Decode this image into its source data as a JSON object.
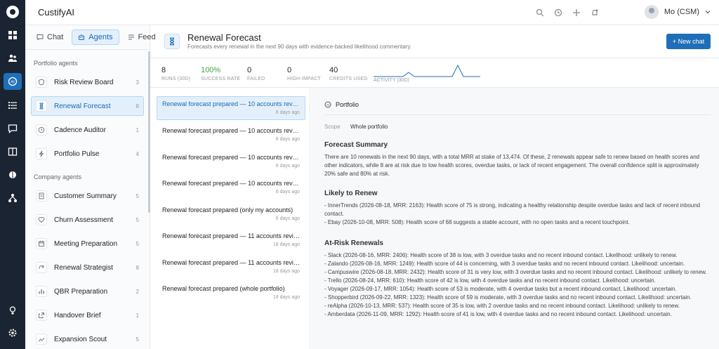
{
  "app": {
    "name": "CustifyAI",
    "user": "Mo (CSM)"
  },
  "rail": {
    "icons": [
      "dashboard-icon",
      "people-icon",
      "agents-icon",
      "list-icon",
      "chat-icon",
      "book-icon",
      "brain-icon",
      "network-icon",
      "bulb-icon",
      "settings-icon"
    ]
  },
  "sidebar": {
    "tabs": [
      {
        "label": "Chat"
      },
      {
        "label": "Agents"
      },
      {
        "label": "Feed"
      }
    ],
    "portfolio_title": "Portfolio agents",
    "portfolio": [
      {
        "label": "Risk Review Board",
        "count": "3"
      },
      {
        "label": "Renewal Forecast",
        "count": "8"
      },
      {
        "label": "Cadence Auditor",
        "count": "1"
      },
      {
        "label": "Portfolio Pulse",
        "count": "4"
      }
    ],
    "company_title": "Company agents",
    "company": [
      {
        "label": "Customer Summary",
        "count": "5"
      },
      {
        "label": "Churn Assessment",
        "count": "5"
      },
      {
        "label": "Meeting Preparation",
        "count": "5"
      },
      {
        "label": "Renewal Strategist",
        "count": "8"
      },
      {
        "label": "QBR Preparation",
        "count": "2"
      },
      {
        "label": "Handover Brief",
        "count": "1"
      },
      {
        "label": "Expansion Scout",
        "count": "5"
      }
    ]
  },
  "header": {
    "title": "Renewal Forecast",
    "subtitle": "Forecasts every renewal in the next 90 days with evidence-backed likelihood commentary.",
    "new_chat": "+ New chat"
  },
  "stats": [
    {
      "value": "8",
      "label": "RUNS (30D)"
    },
    {
      "value": "100%",
      "label": "SUCCESS RATE"
    },
    {
      "value": "0",
      "label": "FAILED"
    },
    {
      "value": "0",
      "label": "HIGH-IMPACT"
    },
    {
      "value": "40",
      "label": "CREDITS USED"
    }
  ],
  "activity_label": "ACTIVITY (30D)",
  "runs": [
    {
      "title": "Renewal forecast prepared — 10 accounts reviewed...",
      "date": "6 days ago"
    },
    {
      "title": "Renewal forecast prepared — 10 accounts reviewed...",
      "date": "6 days ago"
    },
    {
      "title": "Renewal forecast prepared — 10 accounts reviewed...",
      "date": "6 days ago"
    },
    {
      "title": "Renewal forecast prepared — 10 accounts reviewed...",
      "date": "6 days ago"
    },
    {
      "title": "Renewal forecast prepared (only my accounts)",
      "date": "6 days ago"
    },
    {
      "title": "Renewal forecast prepared — 11 accounts reviewed...",
      "date": "18 days ago"
    },
    {
      "title": "Renewal forecast prepared — 11 accounts reviewed...",
      "date": "18 days ago"
    },
    {
      "title": "Renewal forecast prepared (whole portfolio)",
      "date": "18 days ago"
    }
  ],
  "detail": {
    "tag": "Portfolio",
    "scope_label": "Scope",
    "scope_value": "Whole portfolio",
    "summary_title": "Forecast Summary",
    "summary": "There are 10 renewals in the next 90 days, with a total MRR at stake of 13,474. Of these, 2 renewals appear safe to renew based on health scores and other indicators, while 8 are at risk due to low health scores, overdue tasks, or lack of recent engagement. The overall confidence split is approximately 20% safe and 80% at risk.",
    "likely_title": "Likely to Renew",
    "likely": [
      "- InnerTrends (2026-08-18, MRR: 2163): Health score of 75 is strong, indicating a healthy relationship despite overdue tasks and lack of recent inbound contact.",
      "- Ebay (2026-10-08, MRR: 508): Health score of 68 suggests a stable account, with no open tasks and a recent touchpoint."
    ],
    "risk_title": "At-Risk Renewals",
    "risk": [
      "- Slack (2026-08-16, MRR: 2406): Health score of 38 is low, with 3 overdue tasks and no recent inbound contact. Likelihood: unlikely to renew.",
      "- Zalando (2026-08-16, MRR: 1249): Health score of 44 is concerning, with 3 overdue tasks and no recent inbound contact. Likelihood: uncertain.",
      "- Campuswire (2026-08-18, MRR: 2432): Health score of 31 is very low, with 3 overdue tasks and no recent inbound contact. Likelihood: unlikely to renew.",
      "- Trello (2026-08-24, MRR: 610): Health score of 42 is low, with 4 overdue tasks and no recent inbound contact. Likelihood: uncertain.",
      "- Voyager (2026-09-17, MRR: 1054): Health score of 53 is moderate, with 4 overdue tasks but a recent inbound contact. Likelihood: uncertain.",
      "- Shopperbird (2026-09-22, MRR: 1323): Health score of 59 is moderate, with 3 overdue tasks and no recent inbound contact. Likelihood: uncertain.",
      "- reAlpha (2026-10-13, MRR: 537): Health score of 35 is low, with 2 overdue tasks and no recent inbound contact. Likelihood: unlikely to renew.",
      "- Amberdata (2026-11-09, MRR: 1292): Health score of 41 is low, with 4 overdue tasks and no recent inbound contact. Likelihood: uncertain."
    ]
  },
  "colors": {
    "accent": "#1f6fb8",
    "rail": "#1b2433",
    "success": "#3aa84a"
  }
}
